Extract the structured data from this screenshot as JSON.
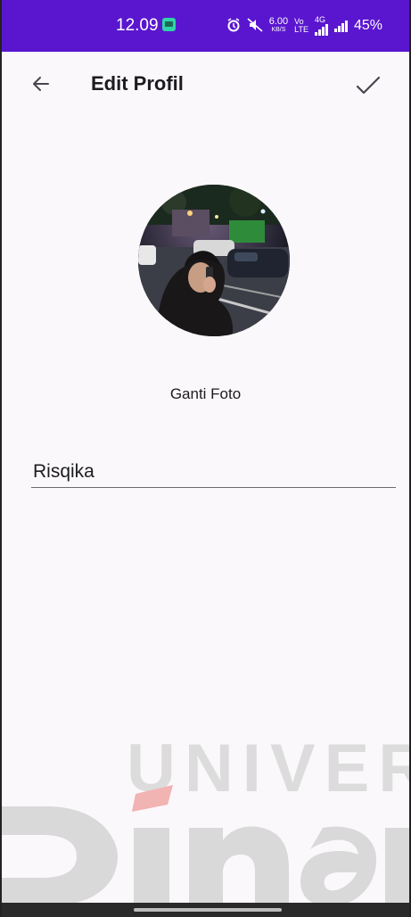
{
  "status_bar": {
    "time": "12.09",
    "net_speed_value": "6.00",
    "net_speed_unit": "KB/S",
    "volte_top": "Vo",
    "volte_bottom": "LTE",
    "network_type": "4G",
    "battery": "45%",
    "background_color": "#5a16cf",
    "icons": [
      "message-notification-icon",
      "alarm-icon",
      "mute-icon",
      "signal-bars-icon",
      "battery-icon"
    ]
  },
  "app_bar": {
    "back_icon": "arrow-left-icon",
    "title": "Edit Profil",
    "save_icon": "check-icon"
  },
  "profile": {
    "avatar": "profile-photo",
    "change_photo_label": "Ganti Foto",
    "name_value": "Risqika"
  },
  "watermark": {
    "text": "UNIVERSIT",
    "logo_letters": "Dinan"
  }
}
